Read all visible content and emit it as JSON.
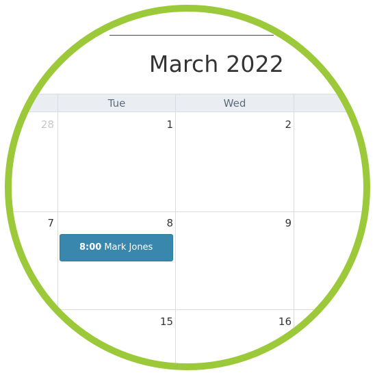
{
  "calendar": {
    "month_title": "March 2022",
    "weekday_headers": [
      "",
      "Tue",
      "Wed",
      ""
    ],
    "weeks": [
      {
        "days": [
          "28",
          "1",
          "2",
          ""
        ]
      },
      {
        "days": [
          "7",
          "8",
          "9",
          ""
        ]
      },
      {
        "days": [
          "",
          "15",
          "16",
          ""
        ]
      }
    ],
    "other_month_days": [
      "28"
    ],
    "events": [
      {
        "time": "8:00",
        "title": "Mark Jones",
        "date": "8"
      }
    ]
  },
  "colors": {
    "ring": "#9bc93a",
    "event_bg": "#3a87ad",
    "header_bg": "#eaeef3",
    "title_rule": "#2c4a7a"
  }
}
